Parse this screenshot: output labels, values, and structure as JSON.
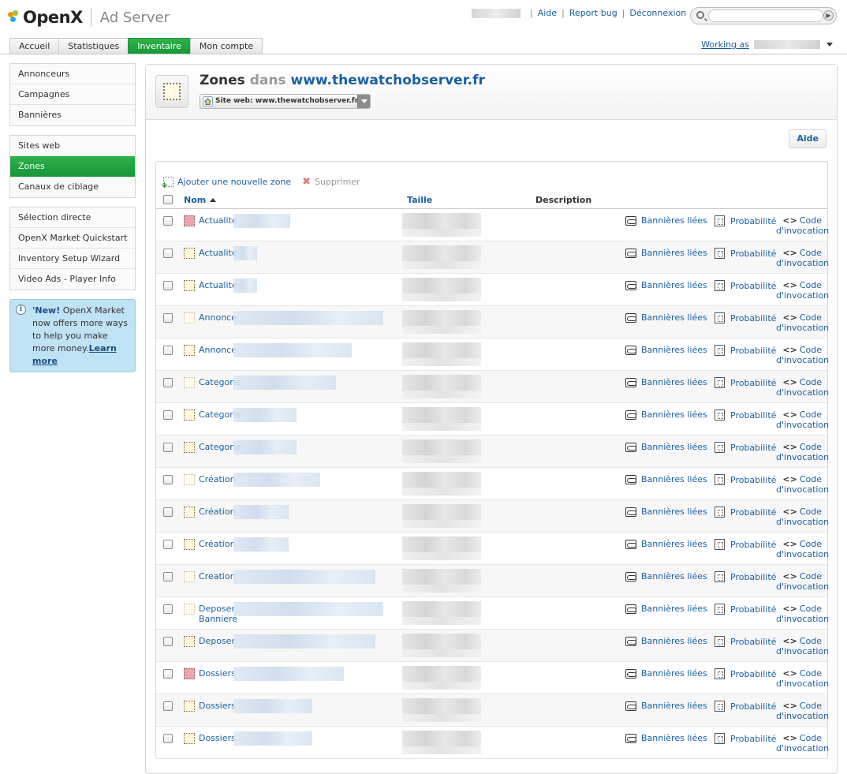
{
  "app": {
    "logo": "OpenX",
    "product": "Ad Server"
  },
  "toplinks": {
    "help": "Aide",
    "report_bug": "Report bug",
    "logout": "Déconnexion"
  },
  "search": {
    "placeholder": ""
  },
  "tabs": [
    {
      "label": "Accueil",
      "active": false
    },
    {
      "label": "Statistiques",
      "active": false
    },
    {
      "label": "Inventaire",
      "active": true
    },
    {
      "label": "Mon compte",
      "active": false
    }
  ],
  "working_as": "Working as",
  "sidebar": {
    "groups": [
      [
        {
          "label": "Annonceurs"
        },
        {
          "label": "Campagnes"
        },
        {
          "label": "Bannières"
        }
      ],
      [
        {
          "label": "Sites web"
        },
        {
          "label": "Zones",
          "active": true
        },
        {
          "label": "Canaux de ciblage"
        }
      ],
      [
        {
          "label": "Sélection directe"
        },
        {
          "label": "OpenX Market Quickstart"
        },
        {
          "label": "Inventory Setup Wizard"
        },
        {
          "label": "Video Ads - Player Info"
        }
      ]
    ],
    "promo": {
      "new": "'New!",
      "text": " OpenX Market now offers more ways to help you make more money.",
      "link": "Learn more"
    }
  },
  "page": {
    "title": "Zones",
    "dans": "dans",
    "site": "www.thewatchobserver.fr",
    "site_select": "Site web: www.thewatchobserver.fr",
    "help_button": "Aide"
  },
  "actions": {
    "add": "Ajouter une nouvelle zone",
    "delete": "Supprimer"
  },
  "columns": {
    "name": "Nom",
    "size": "Taille",
    "description": "Description"
  },
  "row_links": {
    "banners": "Bannières liées",
    "probability": "Probabilité",
    "code": "Code d'invocation"
  },
  "rows": [
    {
      "name": "Actualite",
      "icon": "red",
      "blur": 72
    },
    {
      "name": "Actualite",
      "icon": "normal",
      "blur": 30
    },
    {
      "name": "Actualite",
      "icon": "normal",
      "blur": 30
    },
    {
      "name": "Annonce",
      "icon": "faint",
      "blur": 190
    },
    {
      "name": "Annonce",
      "icon": "normal",
      "blur": 150
    },
    {
      "name": "Categorie",
      "icon": "faint",
      "blur": 130
    },
    {
      "name": "Categorie",
      "icon": "normal",
      "blur": 80
    },
    {
      "name": "Categorie",
      "icon": "normal",
      "blur": 80
    },
    {
      "name": "Création",
      "icon": "faint",
      "blur": 110
    },
    {
      "name": "Création",
      "icon": "normal",
      "blur": 70
    },
    {
      "name": "Création",
      "icon": "normal",
      "blur": 70
    },
    {
      "name": "Creation",
      "icon": "faint",
      "blur": 180
    },
    {
      "name": "Deposer Banniere",
      "icon": "faint",
      "blur": 190
    },
    {
      "name": "Deposer",
      "icon": "normal",
      "blur": 180
    },
    {
      "name": "Dossiers",
      "icon": "red",
      "blur": 140
    },
    {
      "name": "Dossiers",
      "icon": "normal",
      "blur": 100
    },
    {
      "name": "Dossiers",
      "icon": "normal",
      "blur": 100
    }
  ]
}
